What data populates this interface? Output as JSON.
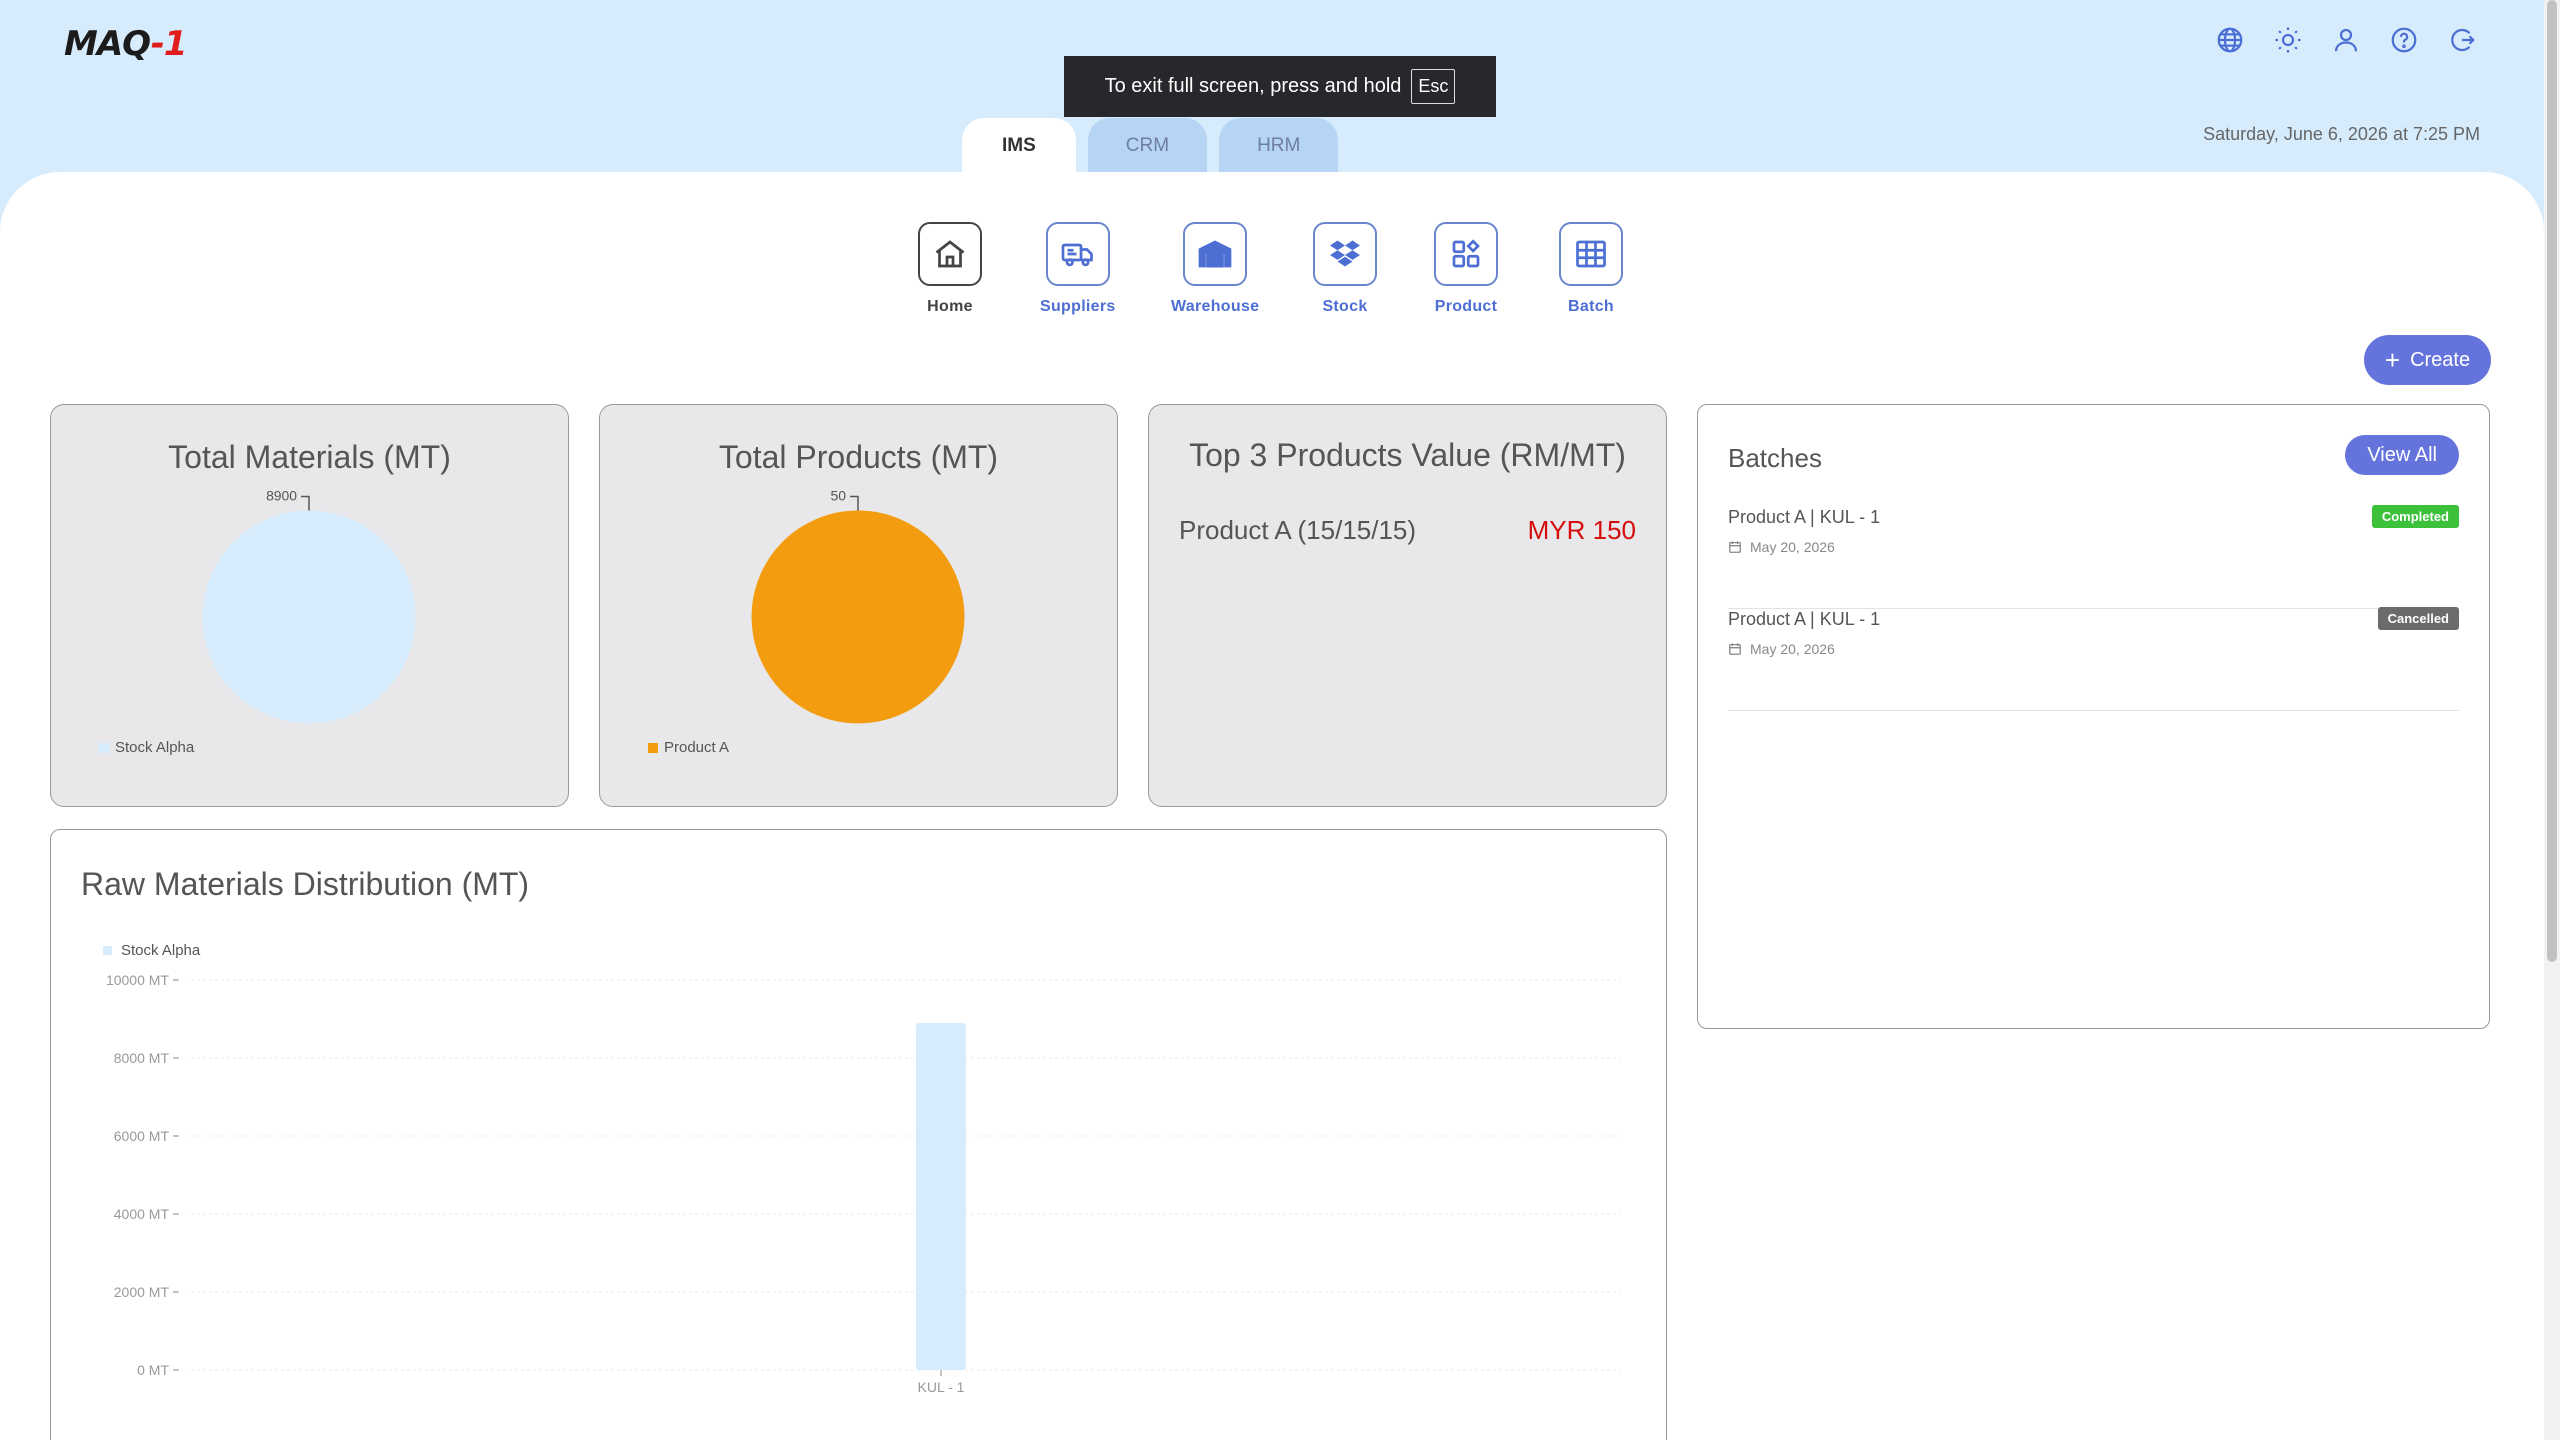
{
  "app": {
    "logo_main": "MAQ",
    "logo_accent": "-1",
    "datetime": "Saturday, June 6, 2026 at 7:25 PM"
  },
  "fullscreen_toast": {
    "message": "To exit full screen, press and hold",
    "key": "Esc"
  },
  "header_icons": [
    "globe-icon",
    "sun-icon",
    "user-icon",
    "help-icon",
    "logout-icon"
  ],
  "tabs": [
    {
      "label": "IMS",
      "active": true
    },
    {
      "label": "CRM",
      "active": false
    },
    {
      "label": "HRM",
      "active": false
    }
  ],
  "nav": [
    {
      "label": "Home",
      "icon": "home-icon"
    },
    {
      "label": "Suppliers",
      "icon": "truck-icon"
    },
    {
      "label": "Warehouse",
      "icon": "warehouse-icon"
    },
    {
      "label": "Stock",
      "icon": "dropbox-icon"
    },
    {
      "label": "Product",
      "icon": "grid-plus-icon"
    },
    {
      "label": "Batch",
      "icon": "table-icon"
    }
  ],
  "create_button": {
    "label": "Create"
  },
  "cards": {
    "total_materials": {
      "title": "Total Materials (MT)",
      "legend": "Stock Alpha",
      "value_label": "8900"
    },
    "total_products": {
      "title": "Total Products (MT)",
      "legend": "Product A",
      "value_label": "50"
    },
    "top_products": {
      "title": "Top 3 Products Value (RM/MT)",
      "items": [
        {
          "name": "Product A (15/15/15)",
          "value": "MYR 150"
        }
      ]
    }
  },
  "batches": {
    "title": "Batches",
    "view_all": "View All",
    "items": [
      {
        "name": "Product A | KUL - 1",
        "date": "May 20, 2026",
        "status": "Completed",
        "status_color": "#3cc13b"
      },
      {
        "name": "Product A | KUL - 1",
        "date": "May 20, 2026",
        "status": "Cancelled",
        "status_color": "#6b6b6b"
      }
    ]
  },
  "raw_materials": {
    "title": "Raw Materials Distribution (MT)"
  },
  "chart_data": [
    {
      "type": "pie",
      "title": "Total Materials (MT)",
      "categories": [
        "Stock Alpha"
      ],
      "values": [
        8900
      ],
      "colors": [
        "#d6ebfb"
      ]
    },
    {
      "type": "pie",
      "title": "Total Products (MT)",
      "categories": [
        "Product A"
      ],
      "values": [
        50
      ],
      "colors": [
        "#f39c0f"
      ]
    },
    {
      "type": "bar",
      "title": "Raw Materials Distribution (MT)",
      "categories": [
        "KUL - 1"
      ],
      "series": [
        {
          "name": "Stock Alpha",
          "values": [
            8900
          ],
          "color": "#d6ebfb"
        }
      ],
      "yticks": [
        "10000 MT",
        "8000 MT",
        "6000 MT",
        "4000 MT",
        "2000 MT",
        "0 MT"
      ],
      "ylim": [
        0,
        10000
      ],
      "legend": "top-left"
    }
  ]
}
